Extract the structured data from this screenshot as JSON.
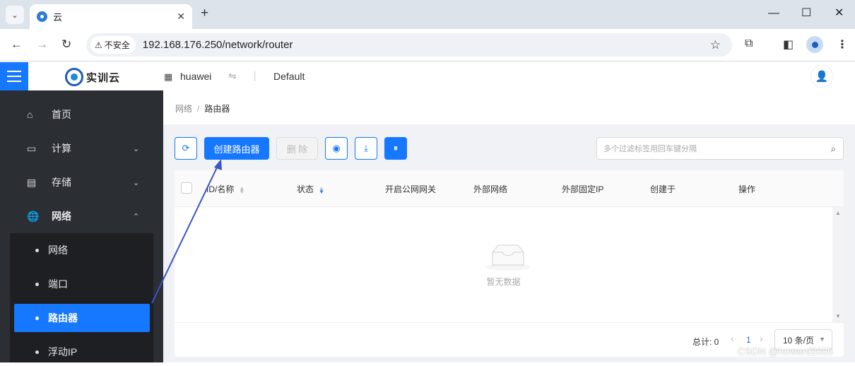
{
  "browser": {
    "tab_title": "云",
    "security_label": "不安全",
    "url": "192.168.176.250/network/router"
  },
  "header": {
    "logo_text": "实训云",
    "project": "huawei",
    "domain": "Default"
  },
  "sidebar": {
    "items": [
      {
        "label": "首页",
        "icon": "home-icon"
      },
      {
        "label": "计算",
        "icon": "monitor-icon"
      },
      {
        "label": "存储",
        "icon": "storage-icon"
      },
      {
        "label": "网络",
        "icon": "globe-icon"
      }
    ],
    "network_sub": [
      {
        "label": "网络"
      },
      {
        "label": "端口"
      },
      {
        "label": "路由器",
        "active": true
      },
      {
        "label": "浮动IP"
      }
    ]
  },
  "breadcrumb": {
    "parent": "网络",
    "current": "路由器"
  },
  "toolbar": {
    "create_label": "创建路由器",
    "delete_label": "删 除"
  },
  "search": {
    "placeholder": "多个过滤标签用回车键分隔"
  },
  "table": {
    "columns": [
      "ID/名称",
      "状态",
      "开启公网网关",
      "外部网络",
      "外部固定IP",
      "创建于",
      "操作"
    ],
    "empty_text": "暂无数据"
  },
  "pagination": {
    "total_label": "总计: 0",
    "current_page": "1",
    "page_size": "10 条/页"
  },
  "watermark": "CSDN @howard2005",
  "colors": {
    "primary": "#1677ff",
    "sidebar_bg": "#2b2e33",
    "annotation_arrow": "#3a55c9"
  }
}
